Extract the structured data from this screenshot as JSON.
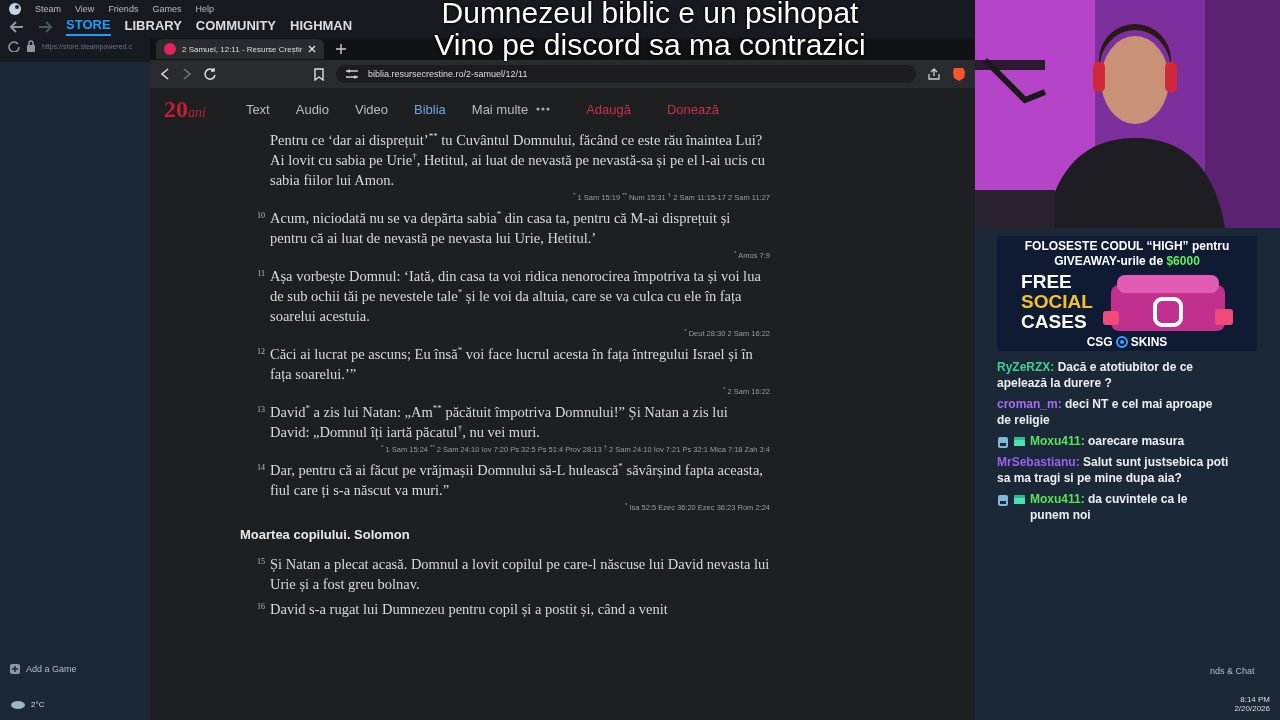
{
  "steam": {
    "menu": [
      "Steam",
      "View",
      "Friends",
      "Games",
      "Help"
    ],
    "nav": [
      {
        "label": "STORE",
        "selected": true
      },
      {
        "label": "LIBRARY",
        "selected": false
      },
      {
        "label": "COMMUNITY",
        "selected": false
      },
      {
        "label": "HIGHMAN",
        "selected": false
      }
    ],
    "url": "https://store.steampowered.c",
    "add_game": "Add a Game",
    "friends_chat": "nds & Chat"
  },
  "browser": {
    "tab": {
      "title": "2 Samuel, 12:11 - Resurse Creștir"
    },
    "url": "biblia.resursecrestine.ro/2-samuel/12/11",
    "logo": {
      "number": "20",
      "word": "ani"
    },
    "site_nav": [
      {
        "label": "Text",
        "kind": "link",
        "selected": false
      },
      {
        "label": "Audio",
        "kind": "link",
        "selected": false
      },
      {
        "label": "Video",
        "kind": "link",
        "selected": false
      },
      {
        "label": "Biblia",
        "kind": "link",
        "selected": true
      },
      {
        "label": "Mai multe",
        "kind": "more",
        "selected": false
      },
      {
        "label": "Adaugă",
        "kind": "action",
        "selected": false
      },
      {
        "label": "Donează",
        "kind": "action",
        "selected": false
      }
    ]
  },
  "passage": [
    {
      "kind": "verse",
      "text": "Pentru ce ‘dar ai disprețuit’$^{**}$ tu Cuvântul Domnului, făcând ce este rău înaintea Lui? Ai lovit cu sabia pe Urie$^{†}$, Hetitul, ai luat de nevastă pe nevastă-sa și pe el l-ai ucis cu sabia fiilor lui Amon.",
      "refs": "$^{*}$ 1 Sam 15:19 $^{**}$ Num 15:31 $^{†}$ 2 Sam 11:15-17 2 Sam 11:27"
    },
    {
      "kind": "verse",
      "number": "10",
      "text": "Acum, niciodată nu se va depărta sabia$^{*}$ din casa ta, pentru că M-ai disprețuit și pentru că ai luat de nevastă pe nevasta lui Urie, Hetitul.’",
      "refs": "$^{*}$ Amos 7:9"
    },
    {
      "kind": "verse",
      "number": "11",
      "text": "Așa vorbește Domnul: ‘Iată, din casa ta voi ridica nenorocirea împotriva ta și voi lua de sub ochii tăi pe nevestele tale$^{*}$ și le voi da altuia, care se va culca cu ele în fața soarelui acestuia.",
      "refs": "$^{*}$ Deut 28:30 2 Sam 16:22"
    },
    {
      "kind": "verse",
      "number": "12",
      "text": "Căci ai lucrat pe ascuns; Eu însă$^{*}$ voi face lucrul acesta în fața întregului Israel și în fața soarelui.’”",
      "refs": "$^{*}$ 2 Sam 16:22"
    },
    {
      "kind": "verse",
      "number": "13",
      "text": "David$^{*}$ a zis lui Natan: „Am$^{**}$ păcătuit împotriva Domnului!” Și Natan a zis lui David: „Domnul îți iartă păcatul$^{†}$, nu vei muri.",
      "refs": "$^{*}$ 1 Sam 15:24 $^{**}$ 2 Sam 24:10 Iov 7:20 Ps 32:5 Ps 51:4 Prov 28:13 $^{†}$ 2 Sam 24:10 Iov 7:21 Ps 32:1 Mica 7:18 Zah 3:4"
    },
    {
      "kind": "verse",
      "number": "14",
      "text": "Dar, pentru că ai făcut pe vrăjmașii Domnului să-L hulească$^{*}$ săvârșind fapta aceasta, fiul care ți s-a născut va muri.”",
      "refs": "$^{*}$ Isa 52:5 Ezec 36:20 Ezec 36:23 Rom 2:24"
    },
    {
      "kind": "heading",
      "text": "Moartea copilului. Solomon"
    },
    {
      "kind": "verse",
      "number": "15",
      "text": "Și Natan a plecat acasă. Domnul a lovit copilul pe care-l născuse lui David nevasta lui Urie și a fost greu bolnav."
    },
    {
      "kind": "verse",
      "number": "16",
      "text": "David s-a rugat lui Dumnezeu pentru copil și a postit și, când a venit"
    }
  ],
  "captions": [
    "Dumnezeul biblic e un psihopat",
    "Vino pe discord sa ma contrazici"
  ],
  "ad": {
    "headline": "FOLOSESTE CODUL “HIGH” pentru",
    "subline": "GIVEAWAY-urile de",
    "amount": "$6000",
    "promo": [
      "FREE",
      "SOCIAL",
      "CASES"
    ],
    "brand_left": "CSG",
    "brand_right": "SKINS"
  },
  "chat": [
    {
      "user": "RyZeRZX:",
      "color": "#3fd08f",
      "badges": false,
      "text": "Dacă e atotiubitor de ce apelează la durere ?"
    },
    {
      "user": "croman_m:",
      "color": "#a66cf5",
      "badges": false,
      "text": "deci NT e cel mai aproape de religie"
    },
    {
      "user": "Moxu411:",
      "color": "#5ee05a",
      "badges": true,
      "text": "oarecare masura"
    },
    {
      "user": "MrSebastianu:",
      "color": "#9c5ff0",
      "badges": false,
      "text": "Salut sunt justsebica poti sa ma tragi si pe mine dupa aia?"
    },
    {
      "user": "Moxu411:",
      "color": "#5ee05a",
      "badges": true,
      "text": "da cuvintele ca le punem noi"
    }
  ],
  "taskbar": {
    "weather": "2°C",
    "time": "8:14 PM",
    "date": "2/20/2026"
  }
}
